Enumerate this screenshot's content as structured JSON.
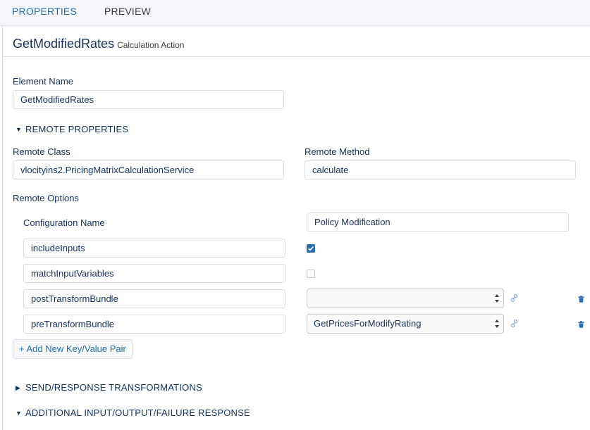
{
  "tabs": [
    {
      "label": "PROPERTIES",
      "active": true
    },
    {
      "label": "PREVIEW",
      "active": false
    }
  ],
  "header": {
    "title": "GetModifiedRates",
    "subtitle": "Calculation Action"
  },
  "element_name": {
    "label": "Element Name",
    "value": "GetModifiedRates"
  },
  "remote_properties": {
    "heading": "REMOTE PROPERTIES",
    "expanded": true,
    "remote_class": {
      "label": "Remote Class",
      "value": "vlocityins2.PricingMatrixCalculationService"
    },
    "remote_method": {
      "label": "Remote Method",
      "value": "calculate"
    },
    "remote_options_label": "Remote Options",
    "options": [
      {
        "key": "Configuration Name",
        "value": "Policy Modification",
        "kind": "text"
      },
      {
        "key": "includeInputs",
        "kind": "checkbox",
        "checked": true
      },
      {
        "key": "matchInputVariables",
        "kind": "checkbox",
        "checked": false
      },
      {
        "key": "postTransformBundle",
        "kind": "select",
        "selected": ""
      },
      {
        "key": "preTransformBundle",
        "kind": "select",
        "selected": "GetPricesForModifyRating"
      }
    ],
    "add_button": "+ Add New Key/Value Pair"
  },
  "sections": [
    {
      "heading": "SEND/RESPONSE TRANSFORMATIONS",
      "expanded": false
    },
    {
      "heading": "ADDITIONAL INPUT/OUTPUT/FAILURE RESPONSE",
      "expanded": true
    }
  ],
  "icons": {
    "expanded_caret": "caret-down-icon",
    "collapsed_caret": "caret-right-icon",
    "link": "link-icon",
    "delete": "trash-icon",
    "select_arrows": "select-arrows-icon",
    "check": "check-icon"
  },
  "colors": {
    "accent": "#2a6fb0",
    "text": "#16325c",
    "border": "#d8dde6",
    "tabbar_bg": "#f4f6f9"
  }
}
